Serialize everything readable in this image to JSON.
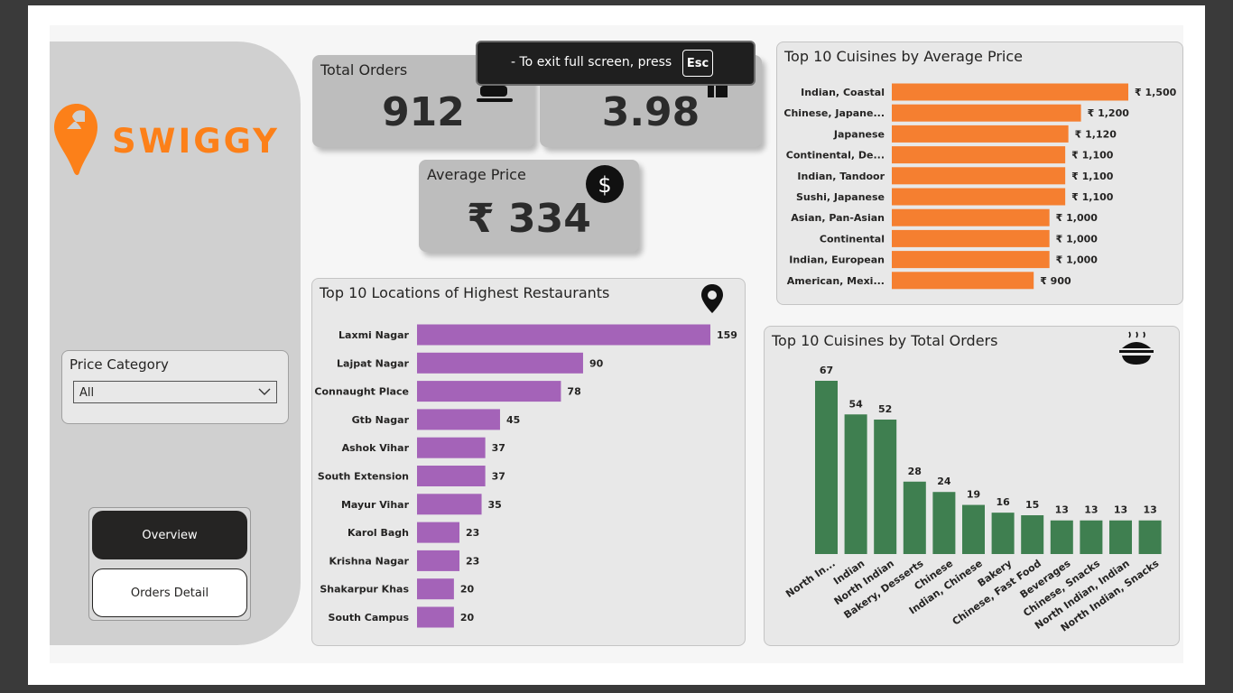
{
  "brand": {
    "name": "SWIGGY",
    "color": "#fc8019"
  },
  "filter": {
    "title": "Price Category",
    "value": "All"
  },
  "nav": {
    "overview": "Overview",
    "orders_detail": "Orders Detail"
  },
  "kpis": {
    "total_orders": {
      "label": "Total Orders",
      "value": "912",
      "icon": "scooter-icon"
    },
    "rating": {
      "value": "3.98",
      "icon": "thumbs-up-icon"
    },
    "average_price": {
      "label": "Average Price",
      "value": "₹ 334",
      "icon": "dollar-circle-icon"
    }
  },
  "toast": {
    "text": "-  To exit full screen, press",
    "key": "Esc"
  },
  "colors": {
    "orange": "#f57f30",
    "purple": "#a463b8",
    "green": "#3f7f50"
  },
  "chart_data": [
    {
      "id": "cuisines_by_price",
      "type": "bar",
      "orientation": "horizontal",
      "title": "Top 10 Cuisines by Average Price",
      "categories": [
        "Indian, Coastal",
        "Chinese, Japane...",
        "Japanese",
        "Continental, De...",
        "Indian, Tandoor",
        "Sushi, Japanese",
        "Asian, Pan-Asian",
        "Continental",
        "Indian, European",
        "American, Mexi..."
      ],
      "values": [
        1500,
        1200,
        1120,
        1100,
        1100,
        1100,
        1000,
        1000,
        1000,
        900
      ],
      "labels": [
        "₹ 1,500",
        "₹ 1,200",
        "₹ 1,120",
        "₹ 1,100",
        "₹ 1,100",
        "₹ 1,100",
        "₹ 1,000",
        "₹ 1,000",
        "₹ 1,000",
        "₹ 900"
      ],
      "color": "#f57f30"
    },
    {
      "id": "locations",
      "type": "bar",
      "orientation": "horizontal",
      "title": "Top 10 Locations of Highest Restaurants",
      "categories": [
        "Laxmi Nagar",
        "Lajpat Nagar",
        "Connaught Place",
        "Gtb Nagar",
        "Ashok Vihar",
        "South Extension",
        "Mayur Vihar",
        "Karol Bagh",
        "Krishna Nagar",
        "Shakarpur Khas",
        "South Campus"
      ],
      "values": [
        159,
        90,
        78,
        45,
        37,
        37,
        35,
        23,
        23,
        20,
        20
      ],
      "labels": [
        "159",
        "90",
        "78",
        "45",
        "37",
        "37",
        "35",
        "23",
        "23",
        "20",
        "20"
      ],
      "color": "#a463b8"
    },
    {
      "id": "cuisines_by_orders",
      "type": "bar",
      "orientation": "vertical",
      "title": "Top 10 Cuisines by Total Orders",
      "categories": [
        "North In...",
        "Indian",
        "North Indian",
        "Bakery, Desserts",
        "Chinese",
        "Indian, Chinese",
        "Bakery",
        "Chinese, Fast Food",
        "Beverages",
        "Chinese, Snacks",
        "North Indian, Indian",
        "North Indian, Snacks"
      ],
      "values": [
        67,
        54,
        52,
        28,
        24,
        19,
        16,
        15,
        13,
        13,
        13,
        13
      ],
      "labels": [
        "67",
        "54",
        "52",
        "28",
        "24",
        "19",
        "16",
        "15",
        "13",
        "13",
        "13",
        "13"
      ],
      "color": "#3f7f50"
    }
  ]
}
